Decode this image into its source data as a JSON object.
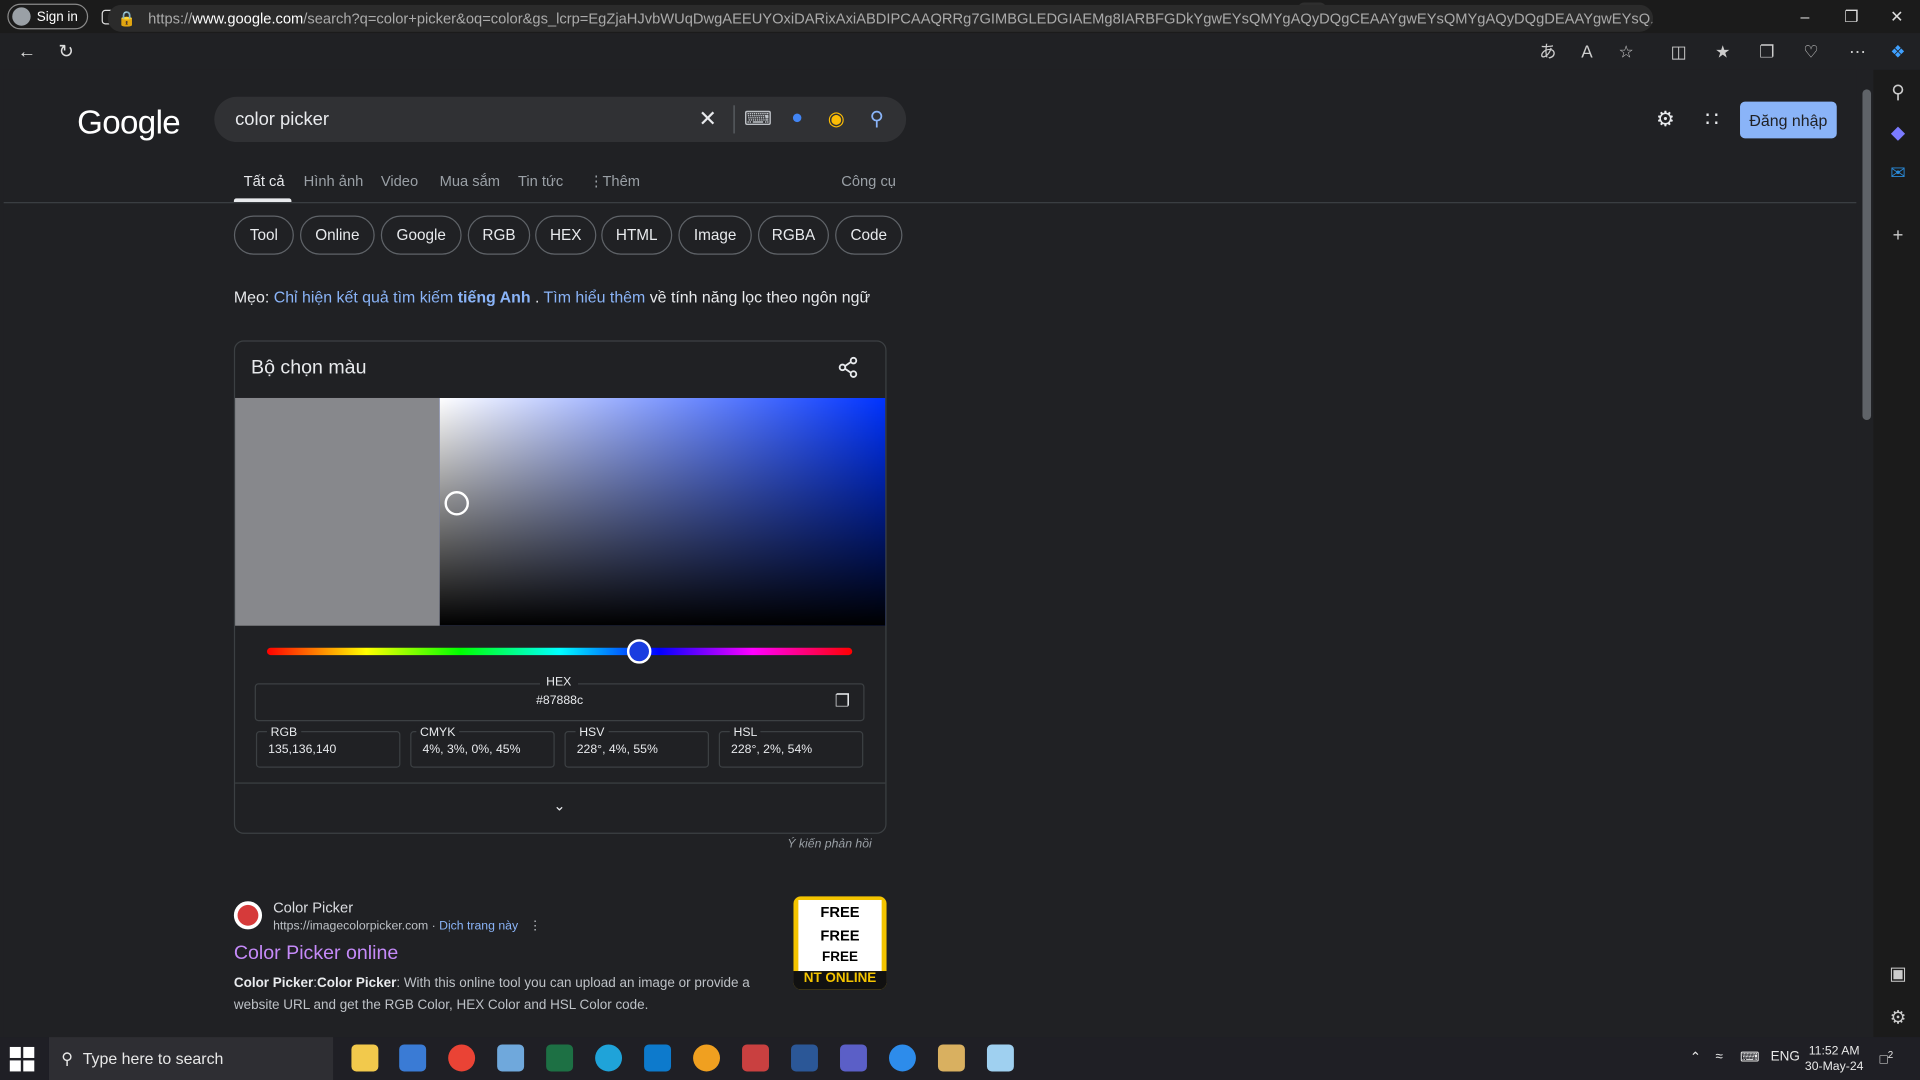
{
  "browser": {
    "signin_label": "Sign in",
    "url_prefix": "https://",
    "url_host": "www.google.com",
    "url_path": "/search?q=color+picker&oq=color&gs_lcrp=EgZjaHJvbWUqDwgAEEUYOxiDARixAxiABDIPCAAQRRg7GIMBGLEDGIAEMg8IARBFGDkYgwEYsQMYgAQyDQgCEAAYgwEYsQMYgAQyDQgDEAAYgwEYsQ..."
  },
  "google": {
    "logo": "Google",
    "search_query": "color picker",
    "login_button": "Đăng nhập",
    "tabs": [
      "Tất cả",
      "Hình ảnh",
      "Video",
      "Mua sắm",
      "Tin tức",
      "Thêm"
    ],
    "tools": "Công cụ",
    "chips": [
      "Tool",
      "Online",
      "Google",
      "RGB",
      "HEX",
      "HTML",
      "Image",
      "RGBA",
      "Code"
    ],
    "tip": {
      "prefix": "Mẹo: ",
      "link1": "Chỉ hiện kết quả tìm kiếm",
      "link1_bold": "tiếng Anh",
      "dot": " . ",
      "link2": "Tìm hiểu thêm",
      "suffix": " về tính năng lọc theo ngôn ngữ"
    }
  },
  "color_picker": {
    "title": "Bộ chọn màu",
    "swatch_color": "#87888c",
    "hue_color": "#0033ff",
    "hex_label": "HEX",
    "hex_value": "#87888c",
    "rgb_label": "RGB",
    "rgb_value": "135,136,140",
    "cmyk_label": "CMYK",
    "cmyk_value": "4%, 3%, 0%, 45%",
    "hsv_label": "HSV",
    "hsv_value": "228°, 4%, 55%",
    "hsl_label": "HSL",
    "hsl_value": "228°, 2%, 54%",
    "feedback": "Ý kiến phản hồi"
  },
  "result": {
    "site_name": "Color Picker",
    "url": "https://imagecolorpicker.com",
    "translate": "Dịch trang này",
    "title": "Color Picker online",
    "desc_bold1": "Color Picker",
    "desc_sep": ":",
    "desc_bold2": "Color Picker",
    "desc_rest": ": With this online tool you can upload an image or provide a website URL and get the RGB Color, HEX Color and HSL Color code.",
    "thumb_lines": [
      "FREE",
      "FREE",
      "FREE"
    ],
    "thumb_band": "NT ONLINE"
  },
  "taskbar": {
    "search_placeholder": "Type here to search",
    "lang": "ENG",
    "time": "11:52 AM",
    "date": "30-May-24",
    "notifications": "2"
  }
}
